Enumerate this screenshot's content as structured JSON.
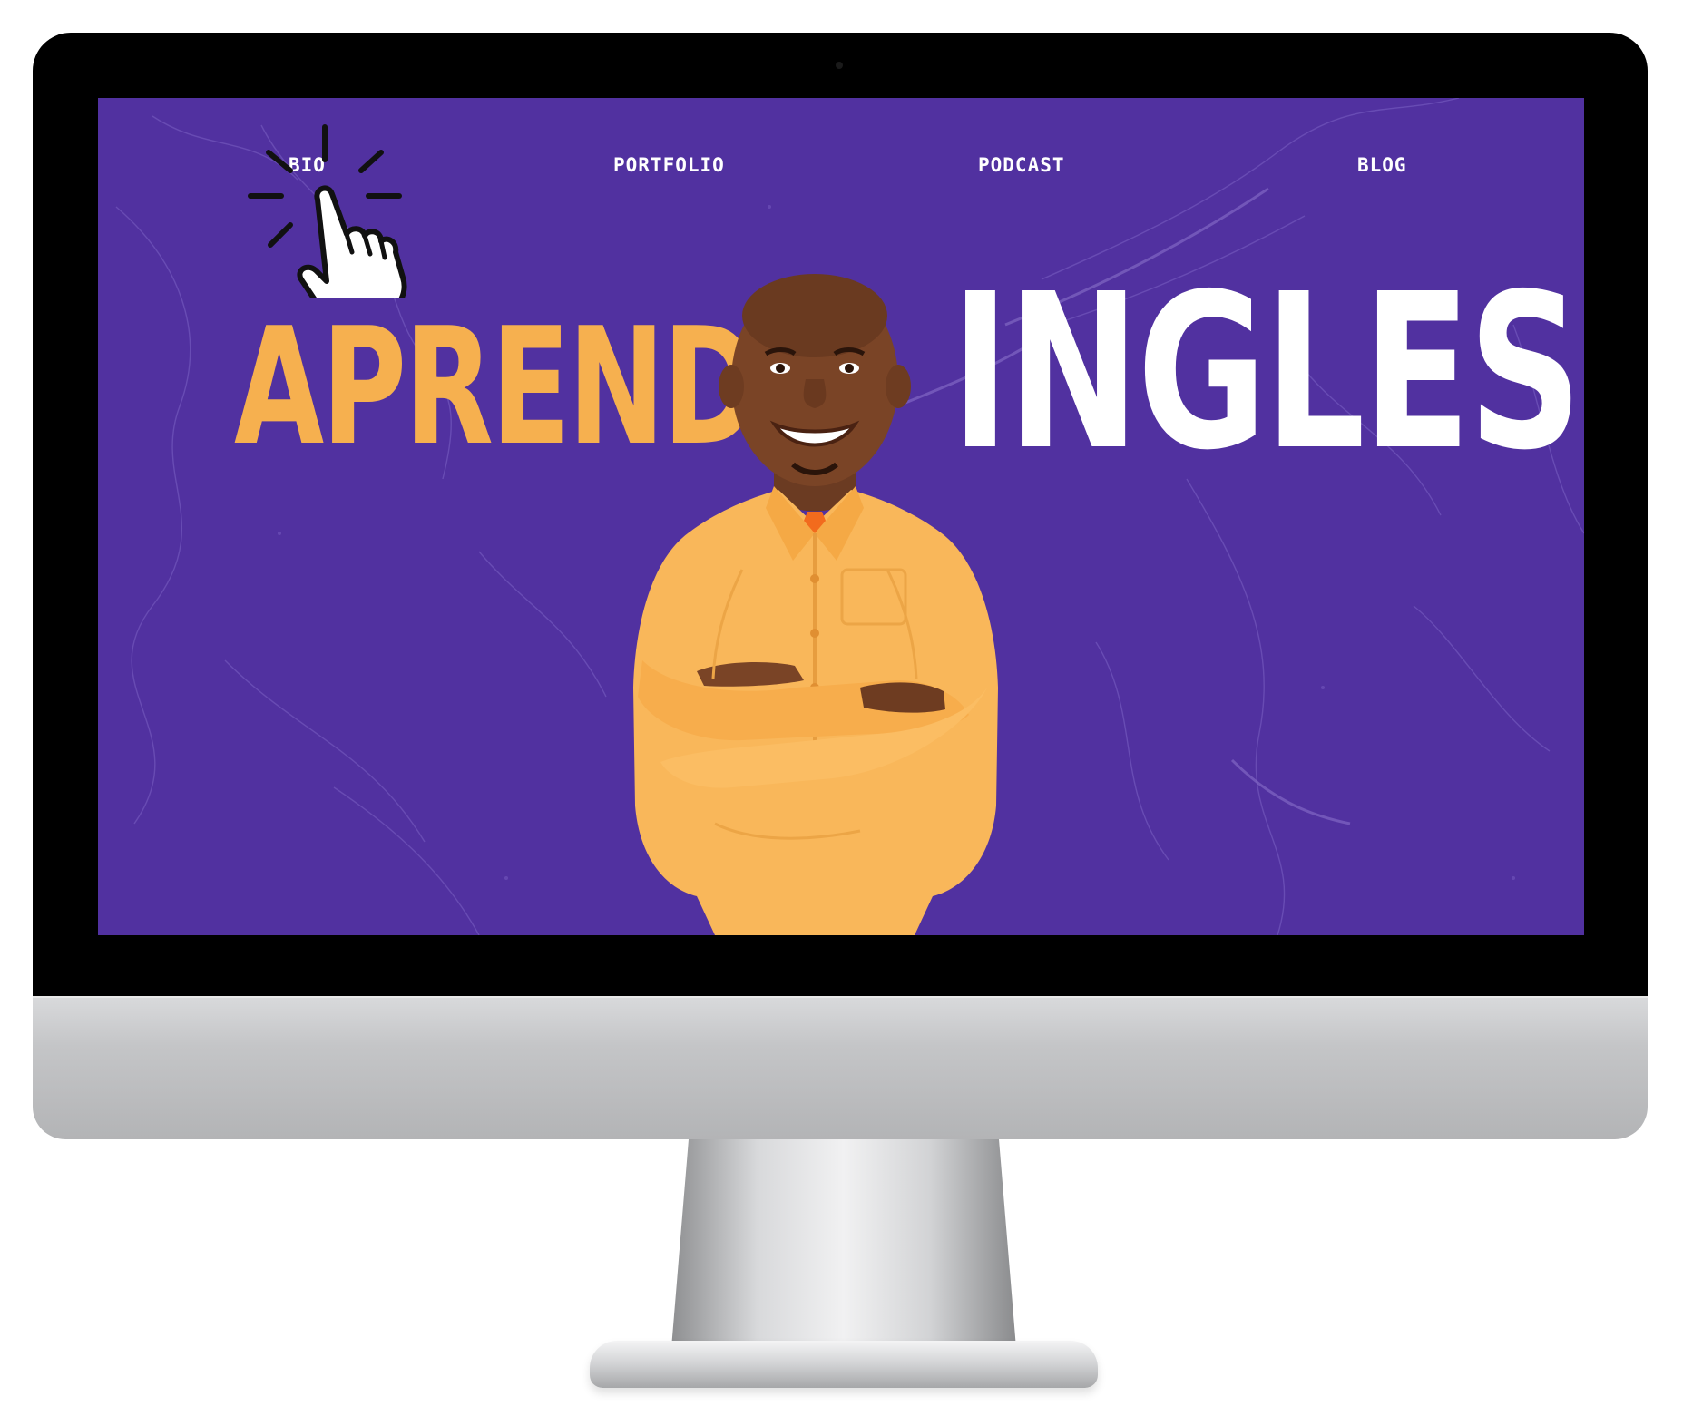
{
  "nav": {
    "items": [
      {
        "label": "BIO"
      },
      {
        "label": "PORTFOLIO"
      },
      {
        "label": "PODCAST"
      },
      {
        "label": "BLOG"
      }
    ]
  },
  "hero": {
    "headline_left": "APRENDE",
    "headline_right": "INGLES"
  },
  "colors": {
    "background": "#5131a0",
    "accent_orange": "#f6b04f",
    "headline_white": "#ffffff",
    "shirt": "#f9b75a"
  },
  "icons": {
    "cursor": "pointing-hand-click-icon"
  }
}
